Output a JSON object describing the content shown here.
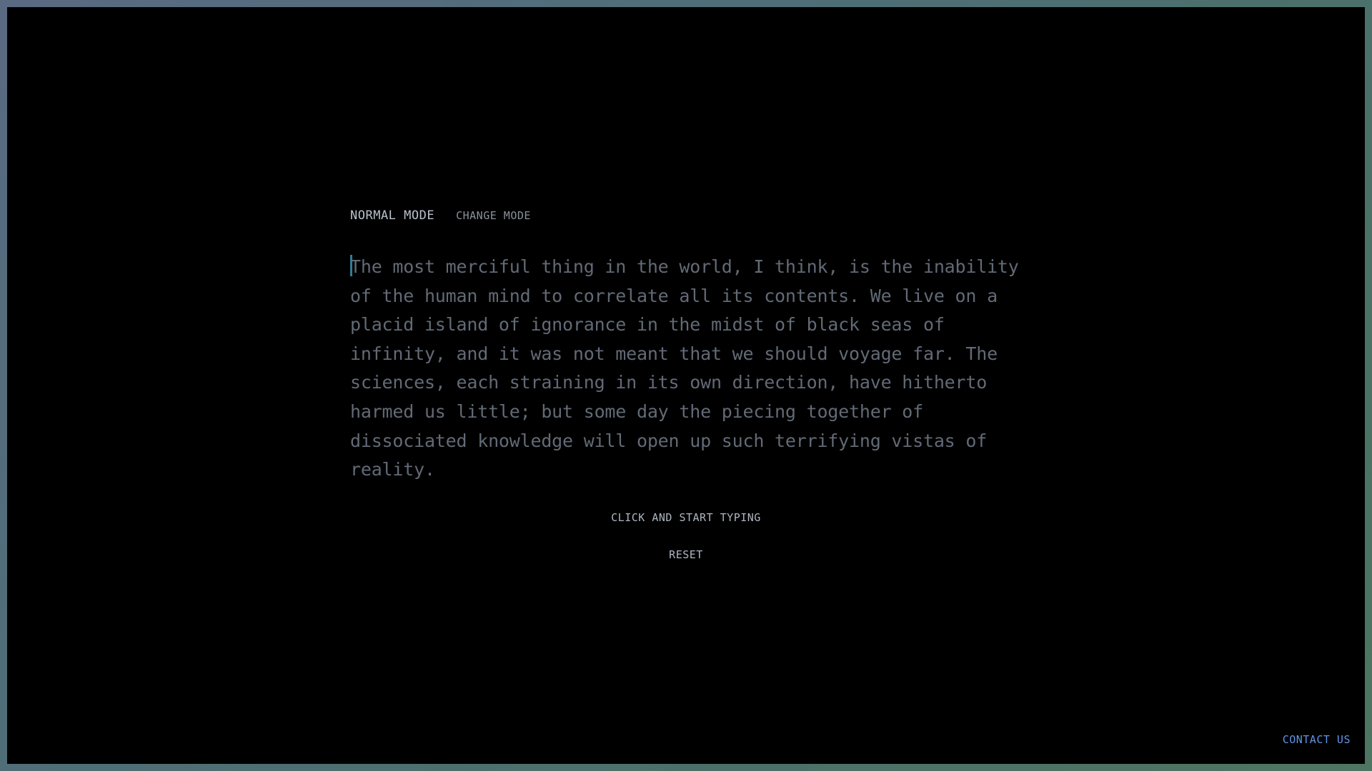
{
  "mode": {
    "current_label": "NORMAL MODE",
    "change_label": "CHANGE MODE"
  },
  "typing": {
    "passage": "The most merciful thing in the world, I think, is the inability of the human mind to correlate all its contents. We live on a placid island of ignorance in the midst of black seas of infinity, and it was not meant that we should voyage far. The sciences, each straining in its own direction, have hitherto harmed us little; but some day the piecing together of dissociated knowledge will open up such terrifying vistas of reality.",
    "caret_color": "#2f7f95",
    "text_color": "#626a76"
  },
  "actions": {
    "start_hint": "CLICK AND START TYPING",
    "reset_label": "RESET"
  },
  "footer": {
    "contact_label": "CONTACT US",
    "link_color": "#5f95e6"
  }
}
